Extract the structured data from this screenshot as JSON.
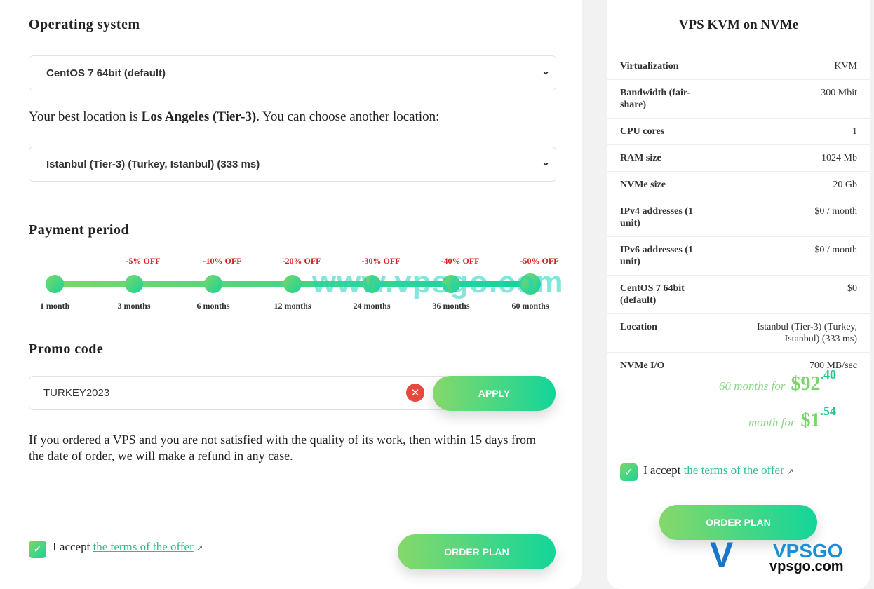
{
  "os": {
    "heading": "Operating system",
    "selected": "CentOS 7 64bit (default)"
  },
  "location": {
    "text_pre": "Your best location is ",
    "best": "Los Angeles (Tier-3)",
    "text_post": ". You can choose another location:",
    "selected": "Istanbul (Tier-3) (Turkey, Istanbul) (333 ms)"
  },
  "payment": {
    "heading": "Payment period",
    "periods": [
      {
        "label": "1 month",
        "discount": ""
      },
      {
        "label": "3 months",
        "discount": "-5% OFF"
      },
      {
        "label": "6 months",
        "discount": "-10% OFF"
      },
      {
        "label": "12 months",
        "discount": "-20% OFF"
      },
      {
        "label": "24 months",
        "discount": "-30% OFF"
      },
      {
        "label": "36 months",
        "discount": "-40% OFF"
      },
      {
        "label": "60 months",
        "discount": "-50% OFF"
      }
    ],
    "selected": "60 months"
  },
  "promo": {
    "heading": "Promo code",
    "value": "TURKEY2023",
    "apply": "APPLY"
  },
  "refund_note": "If you ordered a VPS and you are not satisfied with the quality of its work, then within 15 days from the date of order, we will make a refund in any case.",
  "accept": {
    "prefix": "I accept ",
    "link": "the terms of the offer",
    "checked": true
  },
  "order_label": "ORDER PLAN",
  "summary": {
    "title": "VPS KVM on NVMe",
    "rows": [
      {
        "k": "Virtualization",
        "v": "KVM"
      },
      {
        "k": "Bandwidth (fair-share)",
        "v": "300 Mbit"
      },
      {
        "k": "CPU cores",
        "v": "1"
      },
      {
        "k": "RAM size",
        "v": "1024 Mb"
      },
      {
        "k": "NVMe size",
        "v": "20 Gb"
      },
      {
        "k": "IPv4 addresses (1 unit)",
        "v": "$0 / month"
      },
      {
        "k": "IPv6 addresses (1 unit)",
        "v": "$0 / month"
      },
      {
        "k": "CentOS 7 64bit (default)",
        "v": "$0"
      },
      {
        "k": "Location",
        "v": "Istanbul (Tier-3) (Turkey, Istanbul) (333 ms)"
      },
      {
        "k": "NVMe I/O",
        "v": "700 MB/sec"
      }
    ],
    "total_label": "60 months for",
    "total_int": "$92",
    "total_cents": ".40",
    "monthly_label": "month for",
    "monthly_int": "$1",
    "monthly_cents": ".54"
  },
  "watermark": "www.vpsgo.com",
  "logo": {
    "top": "VPSGO",
    "bottom": "vpsgo.com"
  },
  "colors": {
    "accent_start": "#7bd66a",
    "accent_end": "#12d59a",
    "discount": "#d21f1f",
    "clear": "#e8493c"
  }
}
